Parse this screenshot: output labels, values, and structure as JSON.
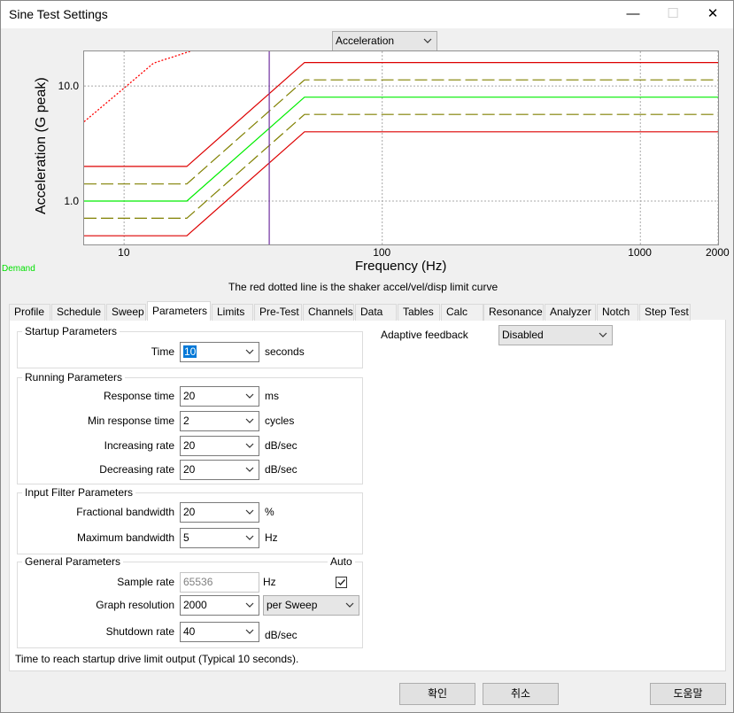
{
  "window": {
    "title": "Sine Test Settings",
    "minimize": "—",
    "maximize": "☐",
    "close": "✕"
  },
  "graph_mode": {
    "selected": "Acceleration"
  },
  "chart_data": {
    "type": "line",
    "xscale": "log",
    "yscale": "log",
    "xlim": [
      7,
      2000
    ],
    "ylim": [
      0.42,
      20
    ],
    "xlabel": "Frequency (Hz)",
    "ylabel": "Acceleration (G peak)",
    "x_ticks": [
      10,
      100,
      1000,
      2000
    ],
    "x_tick_labels": [
      "10",
      "100",
      "1000",
      "2000"
    ],
    "y_ticks": [
      1.0,
      10.0
    ],
    "y_tick_labels": [
      "1.0",
      "10.0"
    ],
    "grid": true,
    "legend_text": "Demand",
    "legend_color": "#00ff00",
    "series": [
      {
        "role": "demand",
        "color": "#00ee00",
        "style": "solid",
        "x": [
          7,
          17.5,
          50,
          2000
        ],
        "y": [
          1.0,
          1.0,
          8.0,
          8.0
        ]
      },
      {
        "role": "warning-upper",
        "color": "#808000",
        "style": "dashed",
        "x": [
          7,
          17.5,
          50,
          2000
        ],
        "y": [
          1.41,
          1.41,
          11.3,
          11.3
        ]
      },
      {
        "role": "warning-lower",
        "color": "#808000",
        "style": "dashed",
        "x": [
          7,
          17.5,
          50,
          2000
        ],
        "y": [
          0.71,
          0.71,
          5.66,
          5.66
        ]
      },
      {
        "role": "abort-upper",
        "color": "#dd0000",
        "style": "solid",
        "x": [
          7,
          17.5,
          50,
          2000
        ],
        "y": [
          2.0,
          2.0,
          16.0,
          16.0
        ]
      },
      {
        "role": "abort-lower",
        "color": "#dd0000",
        "style": "solid",
        "x": [
          7,
          17.5,
          50,
          2000
        ],
        "y": [
          0.5,
          0.5,
          4.0,
          4.0
        ]
      },
      {
        "role": "shaker-limit",
        "color": "#ff0000",
        "style": "dotted",
        "x": [
          7,
          10,
          13,
          18
        ],
        "y": [
          4.9,
          9.6,
          15.8,
          20
        ]
      }
    ],
    "marker_line": {
      "x": 36.5,
      "color": "#7030a0"
    }
  },
  "note": "The red dotted line is the shaker accel/vel/disp limit curve",
  "tabs": [
    {
      "label": "Profile"
    },
    {
      "label": "Schedule"
    },
    {
      "label": "Sweep"
    },
    {
      "label": "Parameters"
    },
    {
      "label": "Limits"
    },
    {
      "label": "Pre-Test"
    },
    {
      "label": "Channels"
    },
    {
      "label": "Data"
    },
    {
      "label": "Tables"
    },
    {
      "label": "Calc"
    },
    {
      "label": "Resonance"
    },
    {
      "label": "Analyzer"
    },
    {
      "label": "Notch"
    },
    {
      "label": "Step Test"
    }
  ],
  "active_tab": "Parameters",
  "startup": {
    "title": "Startup Parameters",
    "time_label": "Time",
    "time_value": "10",
    "time_unit": "seconds"
  },
  "running": {
    "title": "Running Parameters",
    "response_time_label": "Response time",
    "response_time_value": "20",
    "response_time_unit": "ms",
    "min_response_label": "Min response time",
    "min_response_value": "2",
    "min_response_unit": "cycles",
    "increasing_label": "Increasing rate",
    "increasing_value": "20",
    "increasing_unit": "dB/sec",
    "decreasing_label": "Decreasing rate",
    "decreasing_value": "20",
    "decreasing_unit": "dB/sec"
  },
  "input_filter": {
    "title": "Input Filter Parameters",
    "fractional_label": "Fractional bandwidth",
    "fractional_value": "20",
    "fractional_unit": "%",
    "maximum_label": "Maximum bandwidth",
    "maximum_value": "5",
    "maximum_unit": "Hz"
  },
  "general": {
    "title": "General Parameters",
    "auto_label": "Auto",
    "sample_rate_label": "Sample rate",
    "sample_rate_value": "65536",
    "sample_rate_unit": "Hz",
    "auto_checked": true,
    "graph_res_label": "Graph resolution",
    "graph_res_value": "2000",
    "graph_res_mode": "per Sweep",
    "shutdown_label": "Shutdown rate",
    "shutdown_value": "40",
    "shutdown_unit": "dB/sec"
  },
  "adaptive": {
    "label": "Adaptive feedback",
    "value": "Disabled"
  },
  "status_text": "Time to reach startup drive limit output (Typical 10 seconds).",
  "buttons": {
    "ok": "확인",
    "cancel": "취소",
    "help": "도움말"
  }
}
